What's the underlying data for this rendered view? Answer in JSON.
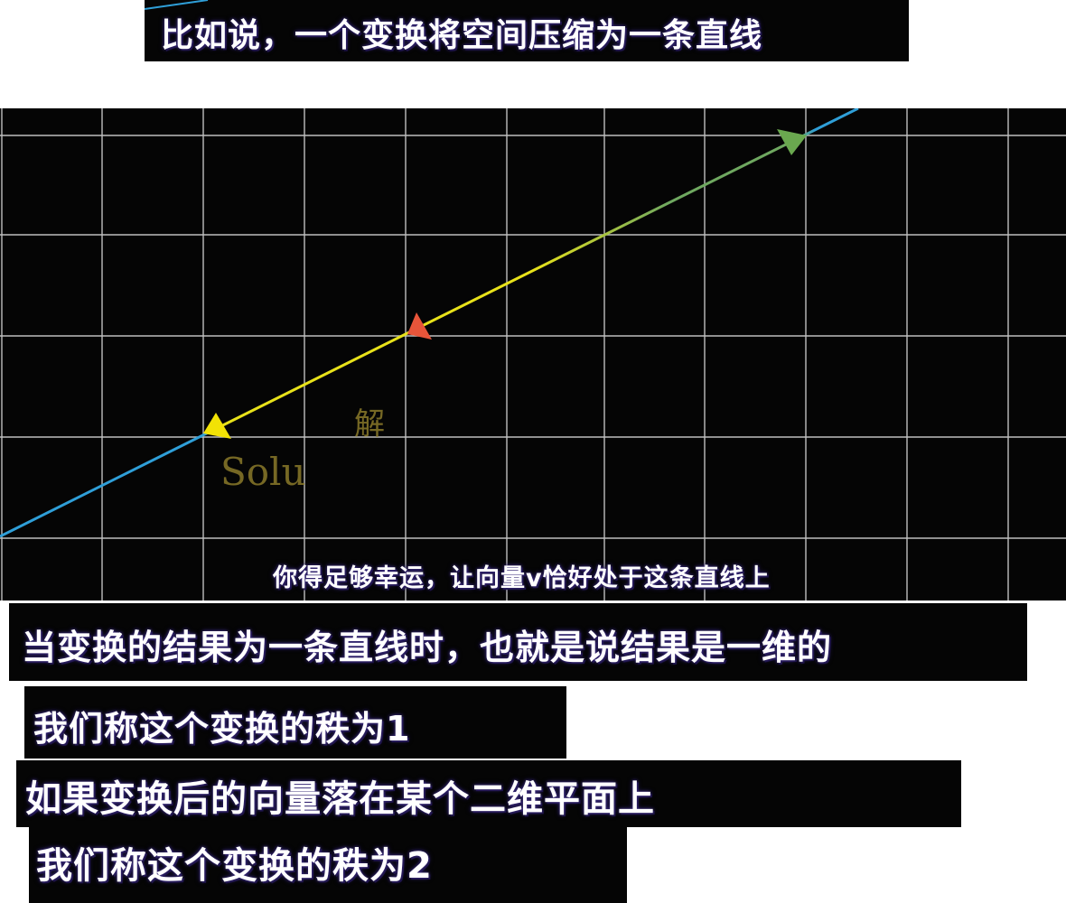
{
  "captions": {
    "top": "比如说，一个变换将空间压缩为一条直线",
    "in_video": "你得足够幸运，让向量v恰好处于这条直线上",
    "line1": "当变换的结果为一条直线时，也就是说结果是一维的",
    "line2": "我们称这个变换的秩为1",
    "line3": "如果变换后的向量落在某个二维平面上",
    "line4": "我们称这个变换的秩为2"
  },
  "watermark": {
    "line1": "解",
    "line2": "Solu"
  },
  "colors": {
    "background": "#050505",
    "grid": "#bfbfbf",
    "line_blue": "#2f9fd8",
    "line_yellow": "#e8e21a",
    "line_green": "#6fa860",
    "arrow_green": "#6aa84f",
    "arrow_red": "#e8553a",
    "arrow_yellow": "#f2e205"
  },
  "icons": [
    "green-arrowhead-icon",
    "red-arrowhead-icon",
    "yellow-arrowhead-icon"
  ]
}
